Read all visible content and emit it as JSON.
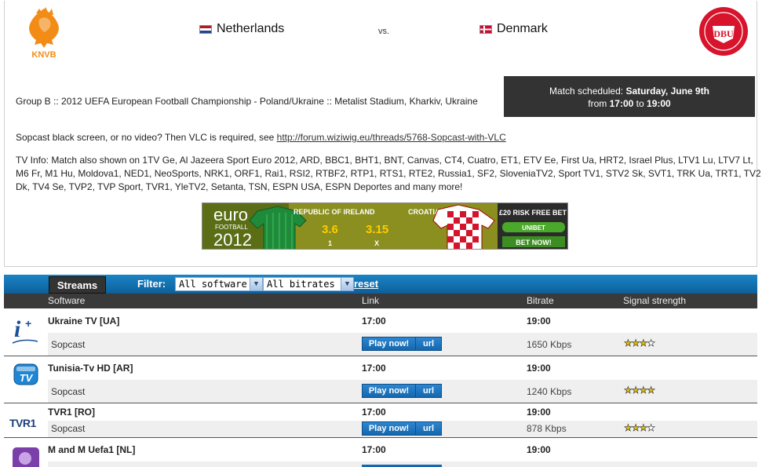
{
  "match": {
    "home_team": "Netherlands",
    "away_team": "Denmark",
    "vs": "vs.",
    "home_logo_text": "KNVB",
    "away_logo_text": "DBU",
    "schedule_prefix": "Match scheduled:",
    "schedule_date": "Saturday, June 9th",
    "schedule_from": "from",
    "schedule_start": "17:00",
    "schedule_to": "to",
    "schedule_end": "19:00",
    "info": "Group B :: 2012 UEFA European Football Championship - Poland/Ukraine :: Metalist Stadium, Kharkiv, Ukraine",
    "vlc_text": "Sopcast black screen, or no video? Then VLC is required, see",
    "vlc_link": "http://forum.wiziwig.eu/threads/5768-Sopcast-with-VLC",
    "tv_info": "TV Info: Match also shown on 1TV Ge, Al Jazeera Sport Euro 2012, ARD, BBC1, BHT1, BNT, Canvas, CT4, Cuatro, ET1, ETV Ee, First Ua, HRT2, Israel Plus, LTV1 Lu, LTV7 Lt, M6 Fr, M1 Hu, Moldova1, NED1, NeoSports, NRK1, ORF1, Rai1, RSI2, RTBF2, RTP1, RTS1, RTE2, Russia1, SF2, SloveniaTV2, Sport TV1, STV2 Sk, SVT1, TRK Ua, TRT1, TV2 Dk, TV4 Se, TVP2, TVP Sport, TVR1, YleTV2, Setanta, TSN, ESPN USA, ESPN Deportes and many more!"
  },
  "banner": {
    "euro": "euro",
    "football": "FOOTBALL",
    "year": "2012",
    "team1": "REPUBLIC OF IRELAND",
    "team2": "CROATIA",
    "odd1": "3.6",
    "odd1_label": "1",
    "oddx": "3.15",
    "oddx_label": "X",
    "promo": "£20 RISK FREE BET",
    "brand": "UNIBET",
    "cta": "BET NOW!"
  },
  "toolbar": {
    "streams_tab": "Streams",
    "filter_label": "Filter:",
    "software_select": "All software",
    "bitrate_select": "All bitrates",
    "reset": "reset"
  },
  "columns": {
    "software": "Software",
    "link": "Link",
    "bitrate": "Bitrate",
    "signal": "Signal strength"
  },
  "streams": [
    {
      "name": "Ukraine TV [UA]",
      "start": "17:00",
      "end": "19:00",
      "software": "Sopcast",
      "play": "Play now!",
      "url": "url",
      "kbps": "1650 Kbps",
      "stars_filled": 3,
      "stars_total": 4
    },
    {
      "name": "Tunisia-Tv HD [AR]",
      "start": "17:00",
      "end": "19:00",
      "software": "Sopcast",
      "play": "Play now!",
      "url": "url",
      "kbps": "1240 Kbps",
      "stars_filled": 4,
      "stars_total": 4
    },
    {
      "name": "TVR1 [RO]",
      "start": "17:00",
      "end": "19:00",
      "software": "Sopcast",
      "play": "Play now!",
      "url": "url",
      "kbps": "878 Kbps",
      "stars_filled": 3,
      "stars_total": 4
    },
    {
      "name": "M and M Uefa1 [NL]",
      "start": "17:00",
      "end": "19:00"
    }
  ],
  "icons": {
    "row1": "i-plus-logo",
    "row2": "tunisia-tv-logo",
    "row2_text": "TV",
    "row3": "tvr1-logo",
    "row3_text": "TVR1",
    "row4": "mm-logo"
  },
  "colors": {
    "header_bar": "#1b84c6",
    "column_header": "#3a3a3a",
    "schedule_box": "#333333",
    "button": "#1567ae",
    "star": "#e0c000"
  }
}
